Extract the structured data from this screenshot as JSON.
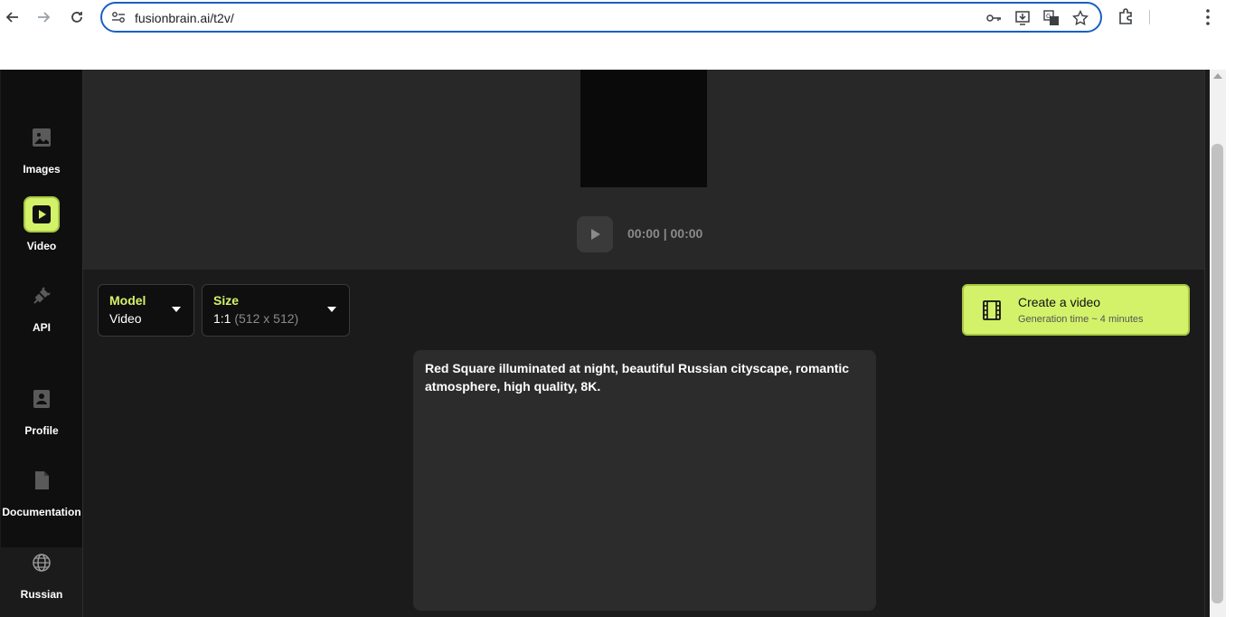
{
  "browser": {
    "url": "fusionbrain.ai/t2v/"
  },
  "sidebar": {
    "items": [
      {
        "label": "Images",
        "icon": "image-icon"
      },
      {
        "label": "Video",
        "icon": "play-icon"
      },
      {
        "label": "API",
        "icon": "plug-icon"
      },
      {
        "label": "Profile",
        "icon": "profile-icon"
      },
      {
        "label": "Documentation",
        "icon": "document-icon"
      },
      {
        "label": "Russian",
        "icon": "globe-icon"
      }
    ]
  },
  "player": {
    "time": "00:00 | 00:00"
  },
  "controls": {
    "model_label": "Model",
    "model_value": "Video",
    "size_label": "Size",
    "size_value": "1:1",
    "size_detail": "(512 x 512)",
    "create_title": "Create a video",
    "create_sub": "Generation time ~ 4 minutes"
  },
  "prompt": {
    "text": "Red Square illuminated at night, beautiful Russian cityscape, romantic atmosphere, high quality, 8K."
  },
  "colors": {
    "accent": "#d3f26a",
    "background": "#1b1b1b",
    "sidebar": "#0f0f0f"
  }
}
